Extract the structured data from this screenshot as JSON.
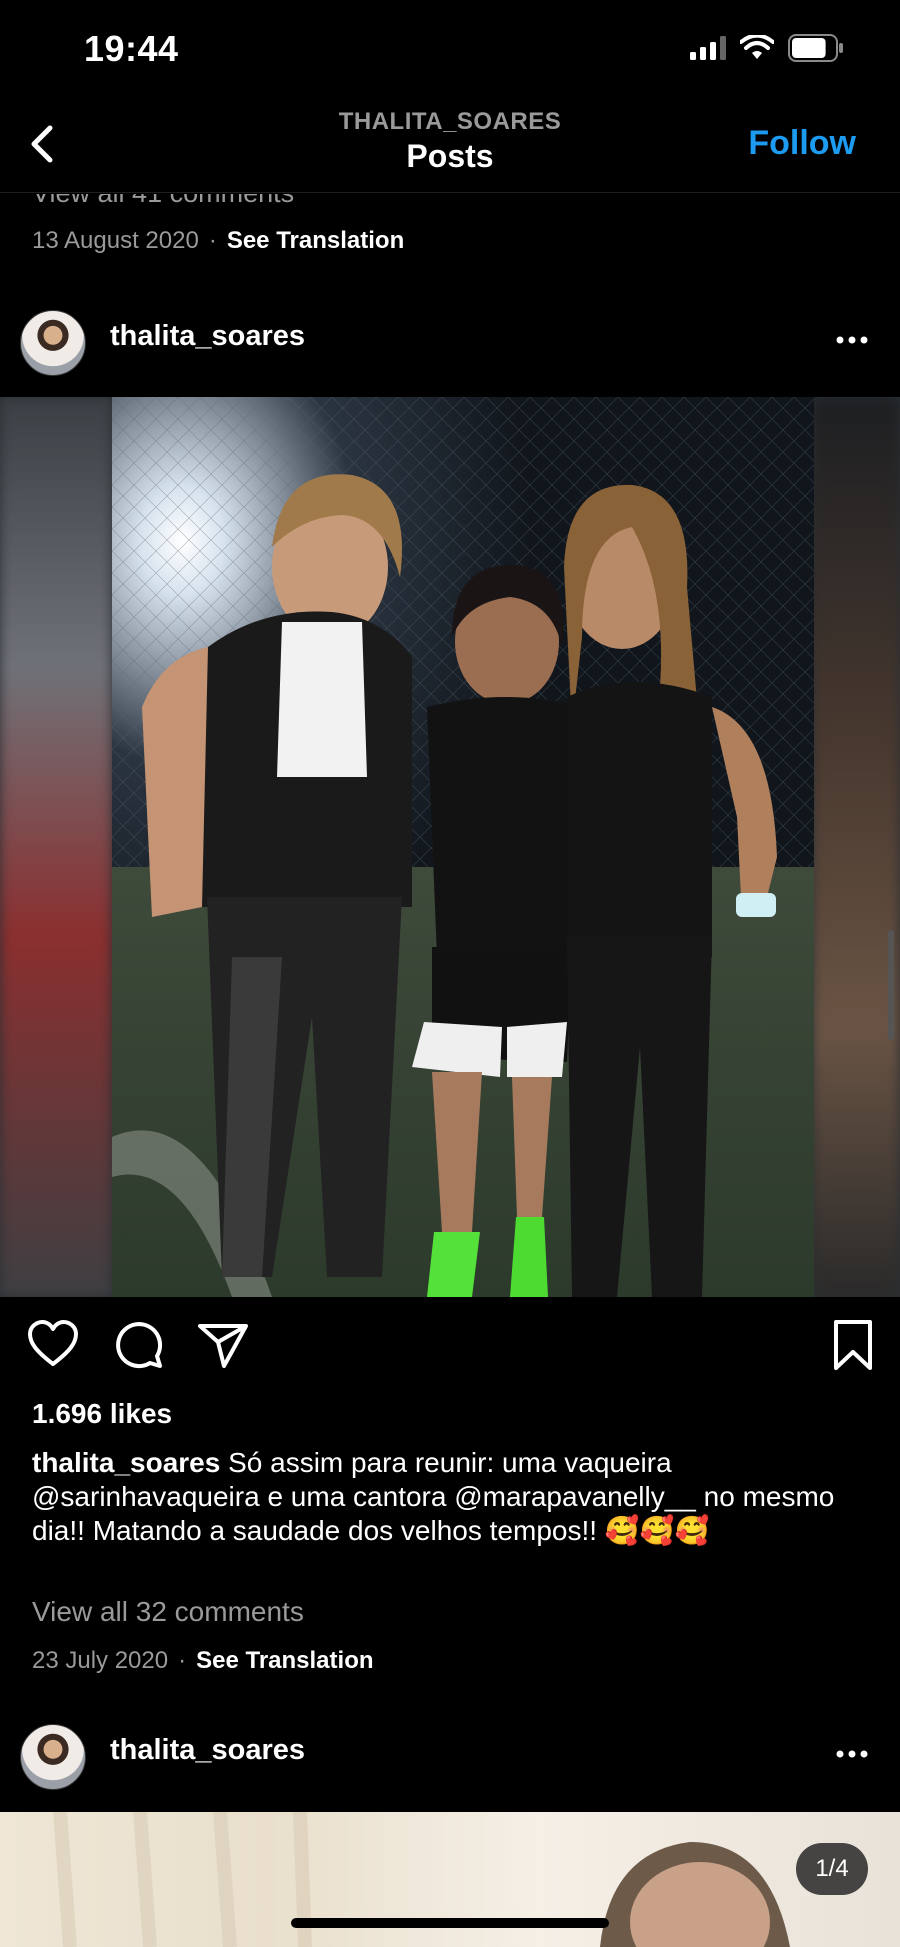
{
  "status_bar": {
    "time": "19:44",
    "battery_level": 0.8
  },
  "nav": {
    "subtitle": "THALITA_SOARES",
    "title": "Posts",
    "follow_label": "Follow"
  },
  "previous_post": {
    "view_comments": "View all 41 comments",
    "date": "13 August 2020",
    "separator": "·",
    "translation_label": "See Translation"
  },
  "post": {
    "username": "thalita_soares",
    "photo_alt": "Three women posing on a football pitch at night",
    "likes": "1.696 likes",
    "caption_user": "thalita_soares",
    "caption_text": "Só assim para reunir: uma vaqueira @sarinhavaqueira e uma cantora @marapavanelly__ no mesmo dia!! Matando a saudade dos velhos tempos!! 🥰🥰🥰",
    "view_comments": "View all 32 comments",
    "date": "23 July 2020",
    "separator": "·",
    "translation_label": "See Translation"
  },
  "next_post": {
    "username": "thalita_soares",
    "carousel_position": "1/4"
  },
  "icons": {
    "back": "chevron-left-icon",
    "more": "ellipsis-icon",
    "like": "heart-icon",
    "comment": "comment-bubble-icon",
    "share": "paper-plane-icon",
    "save": "bookmark-icon"
  },
  "colors": {
    "accent": "#1d9bf0",
    "background": "#000000",
    "muted_text": "#9a9a9a"
  }
}
